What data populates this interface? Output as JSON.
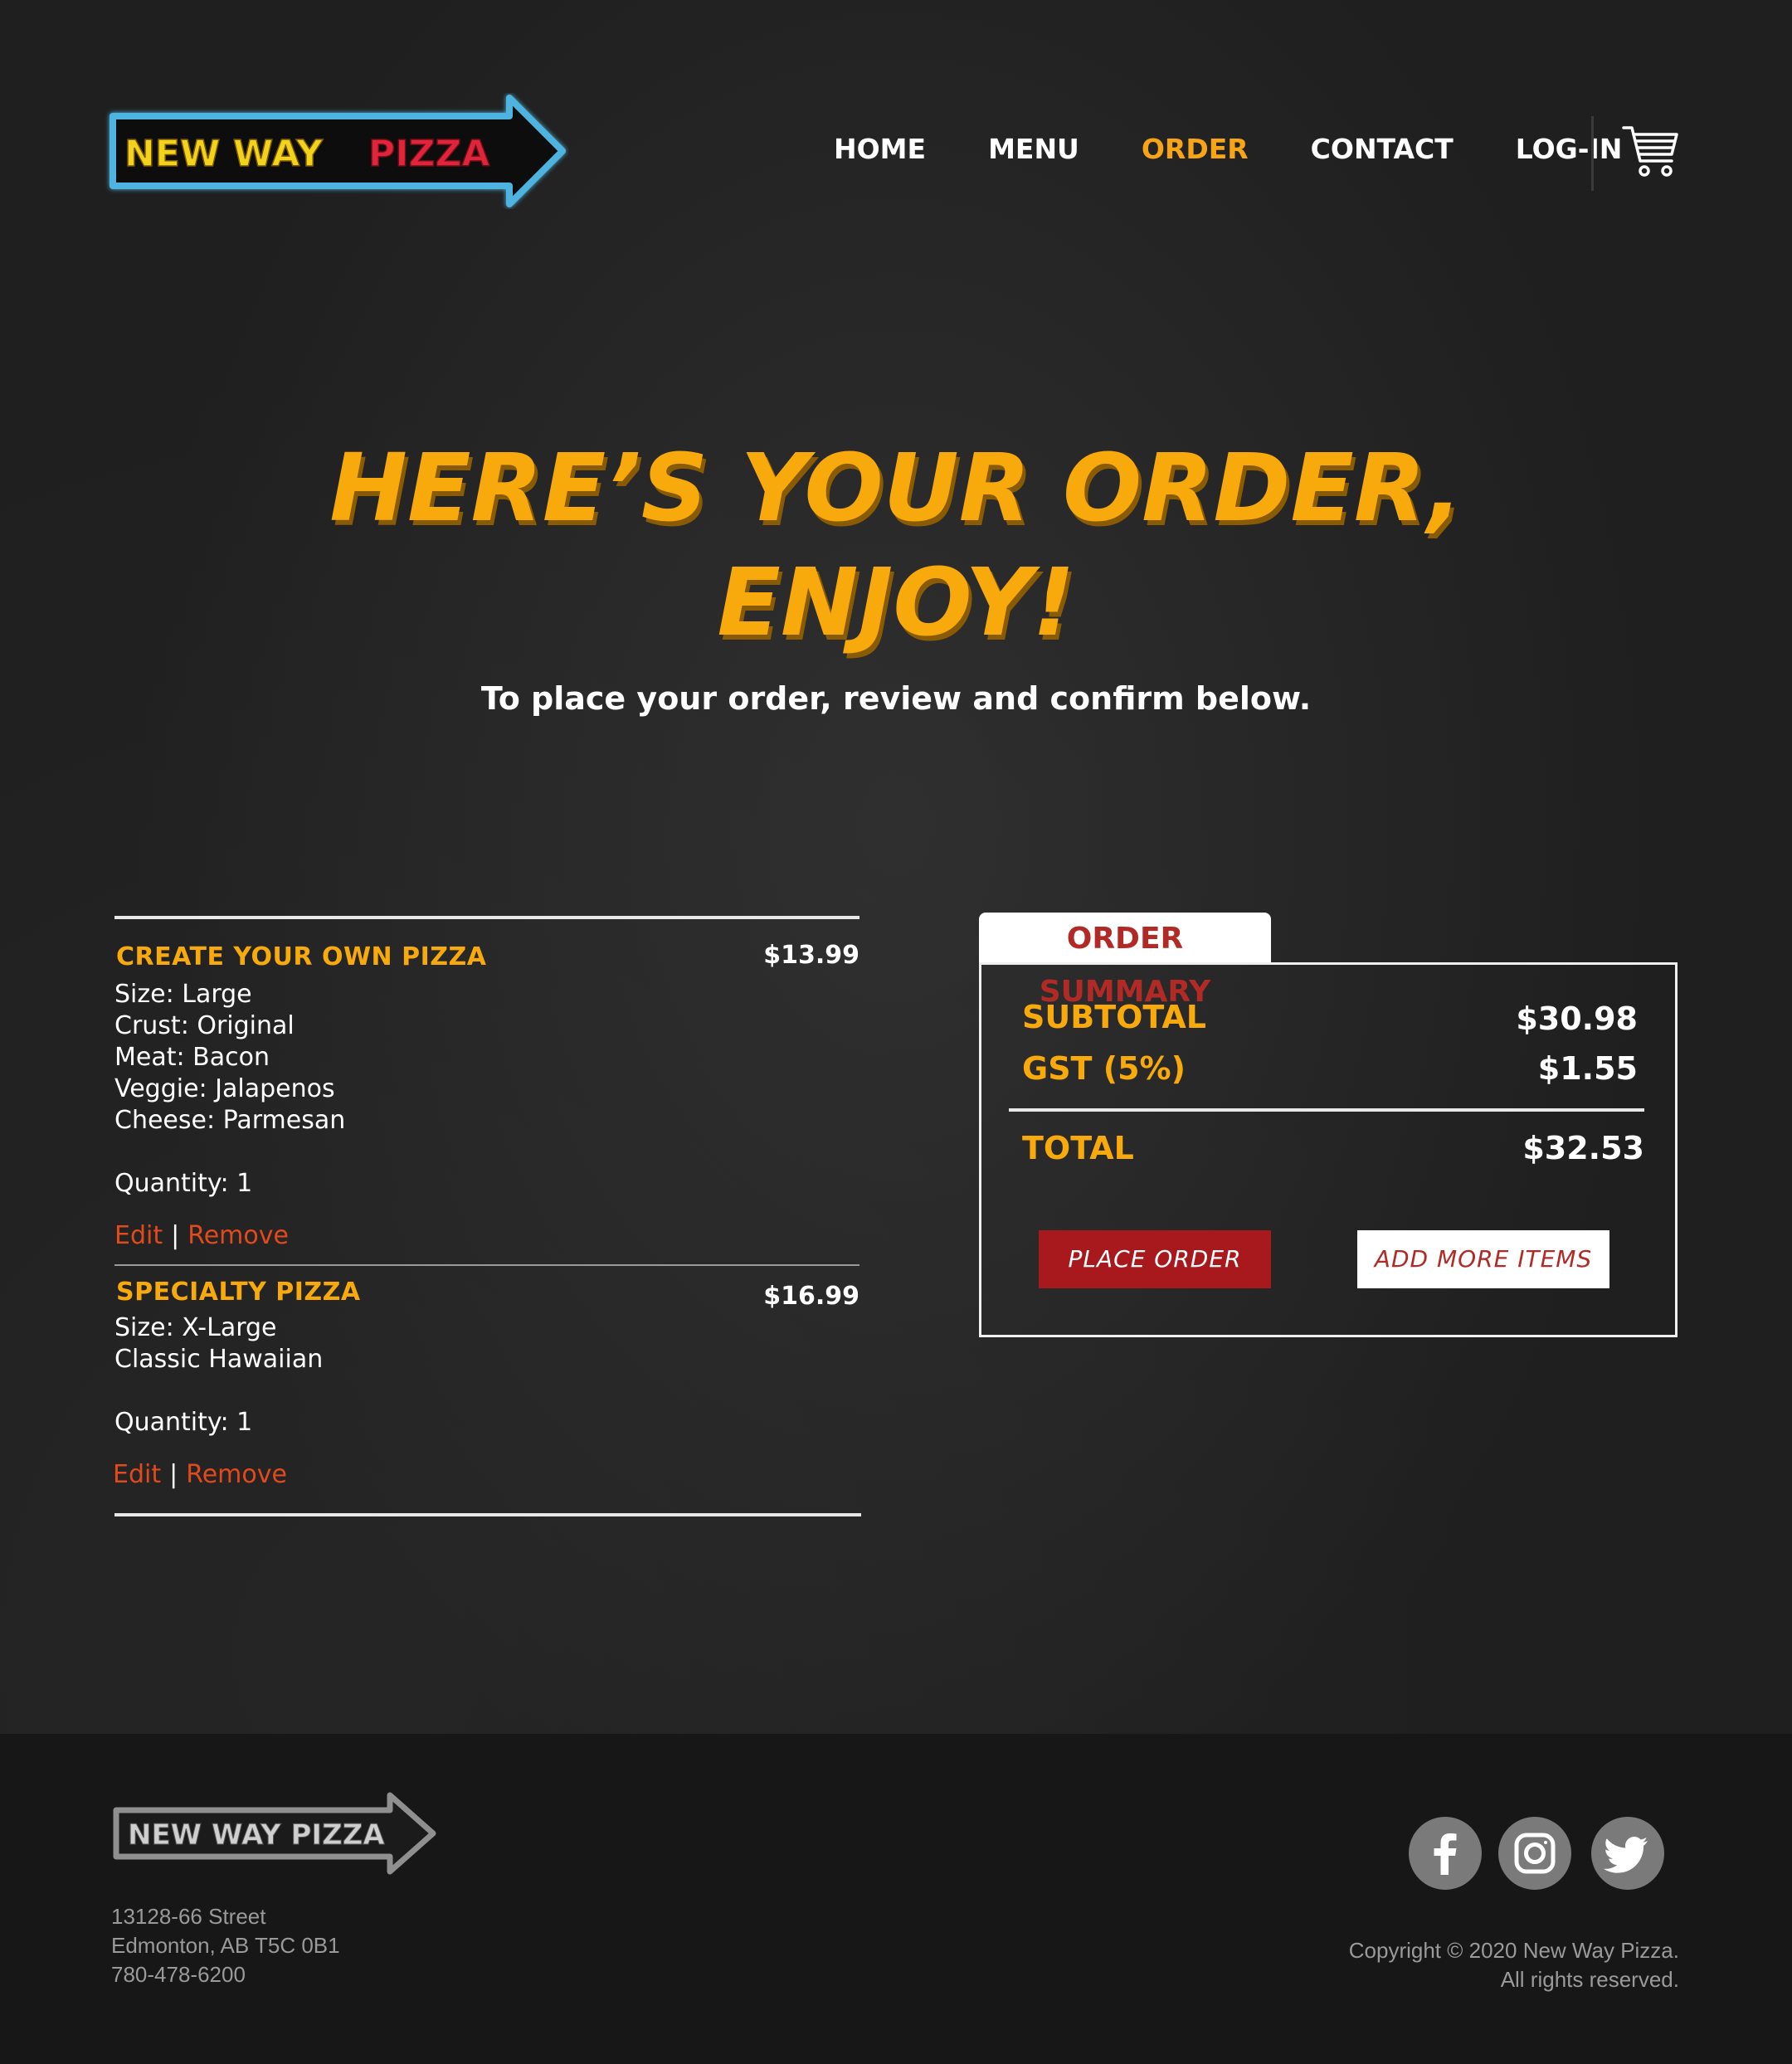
{
  "brand": {
    "logo_text_primary": "NEW WAY",
    "logo_text_accent": "PIZZA",
    "footer_logo_text": "NEW WAY PIZZA"
  },
  "nav": {
    "items": [
      {
        "label": "HOME"
      },
      {
        "label": "MENU"
      },
      {
        "label": "ORDER",
        "active": true
      },
      {
        "label": "CONTACT"
      },
      {
        "label": "LOG-IN"
      }
    ],
    "cart_icon": "shopping-cart-icon"
  },
  "hero": {
    "title_line1": "HERE’S  YOUR  ORDER,",
    "title_line2": "ENJOY!",
    "subtitle": "To place your order, review and confirm below."
  },
  "order_items": [
    {
      "title": "CREATE YOUR OWN PIZZA",
      "price": "$13.99",
      "details": [
        "Size: Large",
        "Crust: Original",
        "Meat: Bacon",
        "Veggie: Jalapenos",
        "Cheese: Parmesan"
      ],
      "quantity": "Quantity: 1",
      "edit_label": "Edit",
      "separator": "|",
      "remove_label": "Remove"
    },
    {
      "title": "SPECIALTY PIZZA",
      "price": "$16.99",
      "details": [
        "Size:  X-Large",
        "Classic Hawaiian"
      ],
      "quantity": "Quantity: 1",
      "edit_label": "Edit",
      "separator": "|",
      "remove_label": "Remove"
    }
  ],
  "summary": {
    "tab_label": "ORDER SUMMARY",
    "subtotal_label": "SUBTOTAL",
    "subtotal_value": "$30.98",
    "gst_label": "GST (5%)",
    "gst_value": "$1.55",
    "total_label": "TOTAL",
    "total_value": "$32.53",
    "place_order_label": "PLACE ORDER",
    "add_more_label": "ADD MORE ITEMS"
  },
  "footer": {
    "address_line1": "13128-66 Street",
    "address_line2": "Edmonton, AB T5C 0B1",
    "phone": "780-478-6200",
    "copyright_line1": "Copyright © 2020 New Way Pizza.",
    "copyright_line2": "All rights reserved.",
    "social": [
      "facebook-icon",
      "instagram-icon",
      "twitter-icon"
    ]
  },
  "colors": {
    "accent_orange": "#f8a90c",
    "link_red": "#e2491b",
    "button_red": "#a8191e",
    "background": "#1f1f1f"
  }
}
